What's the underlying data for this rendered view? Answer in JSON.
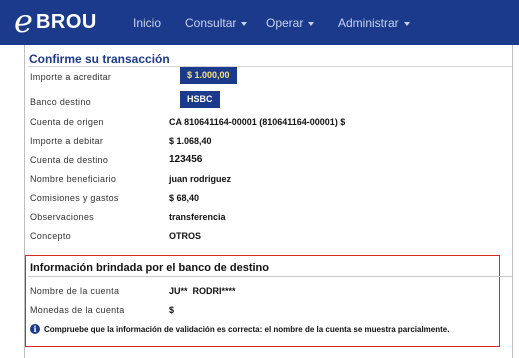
{
  "brand": {
    "logo_letter": "e",
    "name": "BROU"
  },
  "nav": [
    {
      "label": "Inicio",
      "dropdown": false
    },
    {
      "label": "Consultar",
      "dropdown": true
    },
    {
      "label": "Operar",
      "dropdown": true
    },
    {
      "label": "Administrar",
      "dropdown": true
    }
  ],
  "confirm": {
    "title": "Confirme su transacción",
    "rows": [
      {
        "label": "Importe a acreditar",
        "value": "$ 1.000,00"
      },
      {
        "label": "Banco destino",
        "value": "HSBC"
      },
      {
        "label": "Cuenta de origen",
        "value": "CA 810641164-00001 (810641164-00001) $"
      },
      {
        "label": "Importe a debitar",
        "value": "$ 1.068,40"
      },
      {
        "label": "Cuenta de destino",
        "value": "123456"
      },
      {
        "label": "Nombre beneficiario",
        "value": "juan rodriguez"
      },
      {
        "label": "Comisiones y gastos",
        "value": "$ 68,40"
      },
      {
        "label": "Observaciones",
        "value": "transferencia"
      },
      {
        "label": "Concepto",
        "value": "OTROS"
      }
    ]
  },
  "destination": {
    "title": "Información brindada por el banco de destino",
    "rows": [
      {
        "label": "Nombre de la cuenta",
        "value": "JU**  RODRI****"
      },
      {
        "label": "Monedas de la cuenta",
        "value": "$"
      }
    ],
    "info_icon": "info-icon",
    "info_text": "Compruebe que la información de validación es correcta: el nombre de la cuenta se muestra parcialmente."
  },
  "colors": {
    "navbar": "#1c3a8c",
    "highlight_box": "#d62828",
    "amount_text": "#f7e37a"
  }
}
